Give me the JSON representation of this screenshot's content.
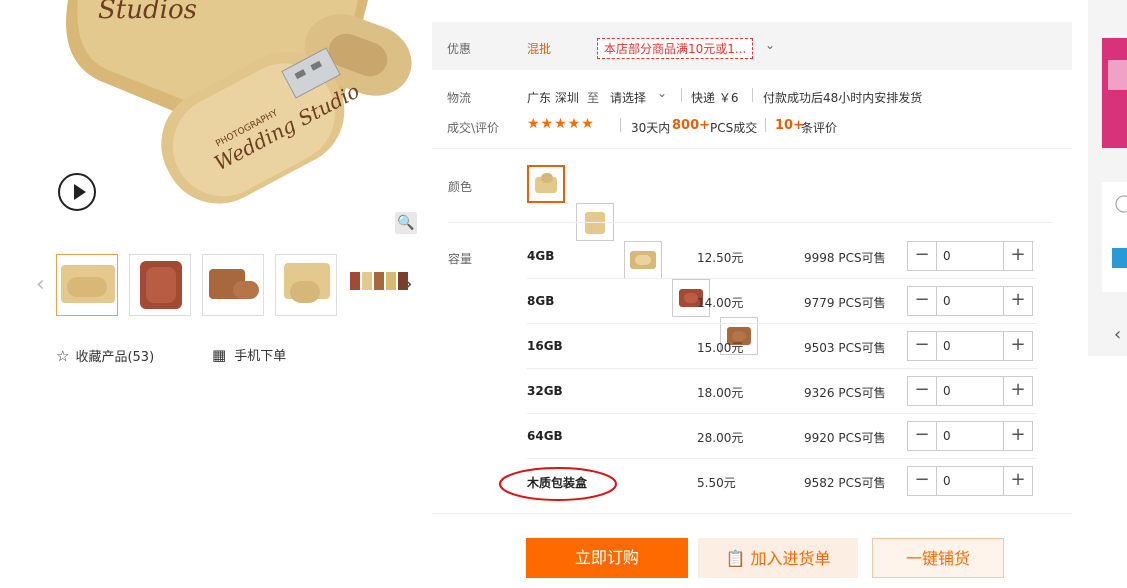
{
  "gallery": {
    "zoom_icon": "search-icon",
    "play_icon": "play-icon",
    "favorite_label": "收藏产品(53)",
    "mobile_order_label": "手机下单",
    "thumbnails": [
      "bamboo-box-usb",
      "redwood-box-usb",
      "walnut-usb",
      "bamboo-usb-open",
      "usb-color-set"
    ]
  },
  "promo": {
    "label": "优惠",
    "tag": "混批",
    "coupon": "本店部分商品满10元或1..."
  },
  "shipping": {
    "label": "物流",
    "from": "广东 深圳",
    "to_word": "至",
    "select": "请选择",
    "express": "快递 ￥6",
    "dispatch": "付款成功后48小时内安排发货"
  },
  "reviews": {
    "label": "成交\\评价",
    "stars": "★★★★★",
    "days_prefix": "30天内",
    "deals": "800+",
    "deals_suffix": "PCS成交",
    "reviews_count": "10+",
    "reviews_suffix": "条评价"
  },
  "colors": {
    "label": "颜色",
    "selected_index": 0,
    "swatches": [
      "bamboo",
      "bamboo-light",
      "bamboo-box",
      "redwood",
      "walnut"
    ]
  },
  "capacity": {
    "label": "容量",
    "rows": [
      {
        "name": "4GB",
        "price": "12.50元",
        "stock": "9998 PCS可售",
        "qty": "0"
      },
      {
        "name": "8GB",
        "price": "14.00元",
        "stock": "9779 PCS可售",
        "qty": "0"
      },
      {
        "name": "16GB",
        "price": "15.00元",
        "stock": "9503 PCS可售",
        "qty": "0"
      },
      {
        "name": "32GB",
        "price": "18.00元",
        "stock": "9326 PCS可售",
        "qty": "0"
      },
      {
        "name": "64GB",
        "price": "28.00元",
        "stock": "9920 PCS可售",
        "qty": "0"
      },
      {
        "name": "木质包装盒",
        "price": "5.50元",
        "stock": "9582 PCS可售",
        "qty": "0"
      }
    ]
  },
  "actions": {
    "buy_now": "立即订购",
    "add_cart": "加入进货单",
    "one_key": "一键铺货"
  },
  "colors_theme": {
    "accent": "#ff6a00",
    "price_accent": "#e6600c",
    "coupon_red": "#ee3333"
  }
}
